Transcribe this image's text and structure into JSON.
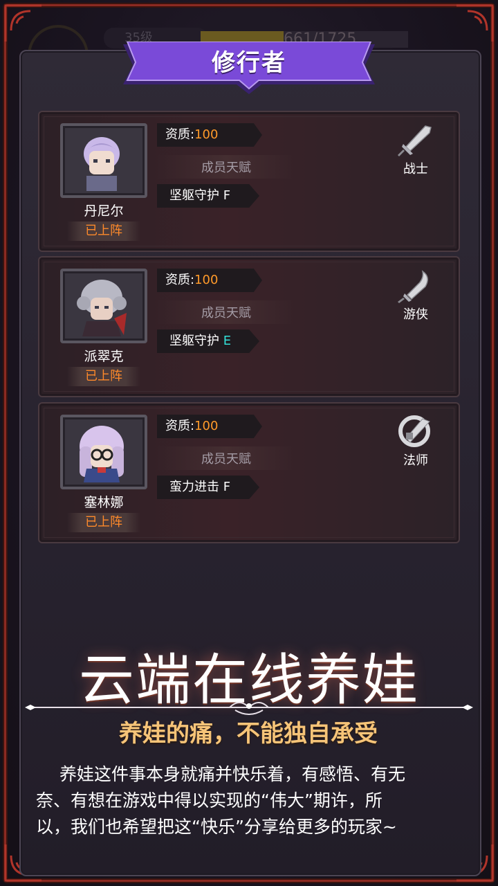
{
  "background": {
    "level_label": "35级",
    "exp_text": "661/1725"
  },
  "title": "修行者",
  "members": [
    {
      "name": "丹尼尔",
      "status": "已上阵",
      "aptitude_label": "资质:",
      "aptitude_value": "100",
      "talent_label": "成员天赋",
      "talent_name": "坚躯守护",
      "talent_grade": "F",
      "class_name": "战士",
      "class_icon": "sword-icon",
      "hair_color": "#c9b8e8"
    },
    {
      "name": "派翠克",
      "status": "已上阵",
      "aptitude_label": "资质:",
      "aptitude_value": "100",
      "talent_label": "成员天赋",
      "talent_name": "坚躯守护",
      "talent_grade": "E",
      "class_name": "游侠",
      "class_icon": "dagger-icon",
      "hair_color": "#b8b8c4"
    },
    {
      "name": "塞林娜",
      "status": "已上阵",
      "aptitude_label": "资质:",
      "aptitude_value": "100",
      "talent_label": "成员天赋",
      "talent_name": "蛮力进击",
      "talent_grade": "F",
      "class_name": "法师",
      "class_icon": "staff-orb-icon",
      "hair_color": "#d8c4ec"
    }
  ],
  "promo": {
    "headline": "云端在线养娃",
    "subheadline": "养娃的痛，不能独自承受",
    "body_lines": [
      "养娃这件事本身就痛并快乐着，有感悟、有无",
      "奈、有想在游戏中得以实现的“伟大”期许，所",
      "以，我们也希望把这“快乐”分享给更多的玩家~"
    ]
  },
  "colors": {
    "accent_orange": "#ff9a2a",
    "grade_E": "#33e0d8",
    "banner_purple": "#7a4ad8",
    "frame_red": "#8c2a22"
  }
}
